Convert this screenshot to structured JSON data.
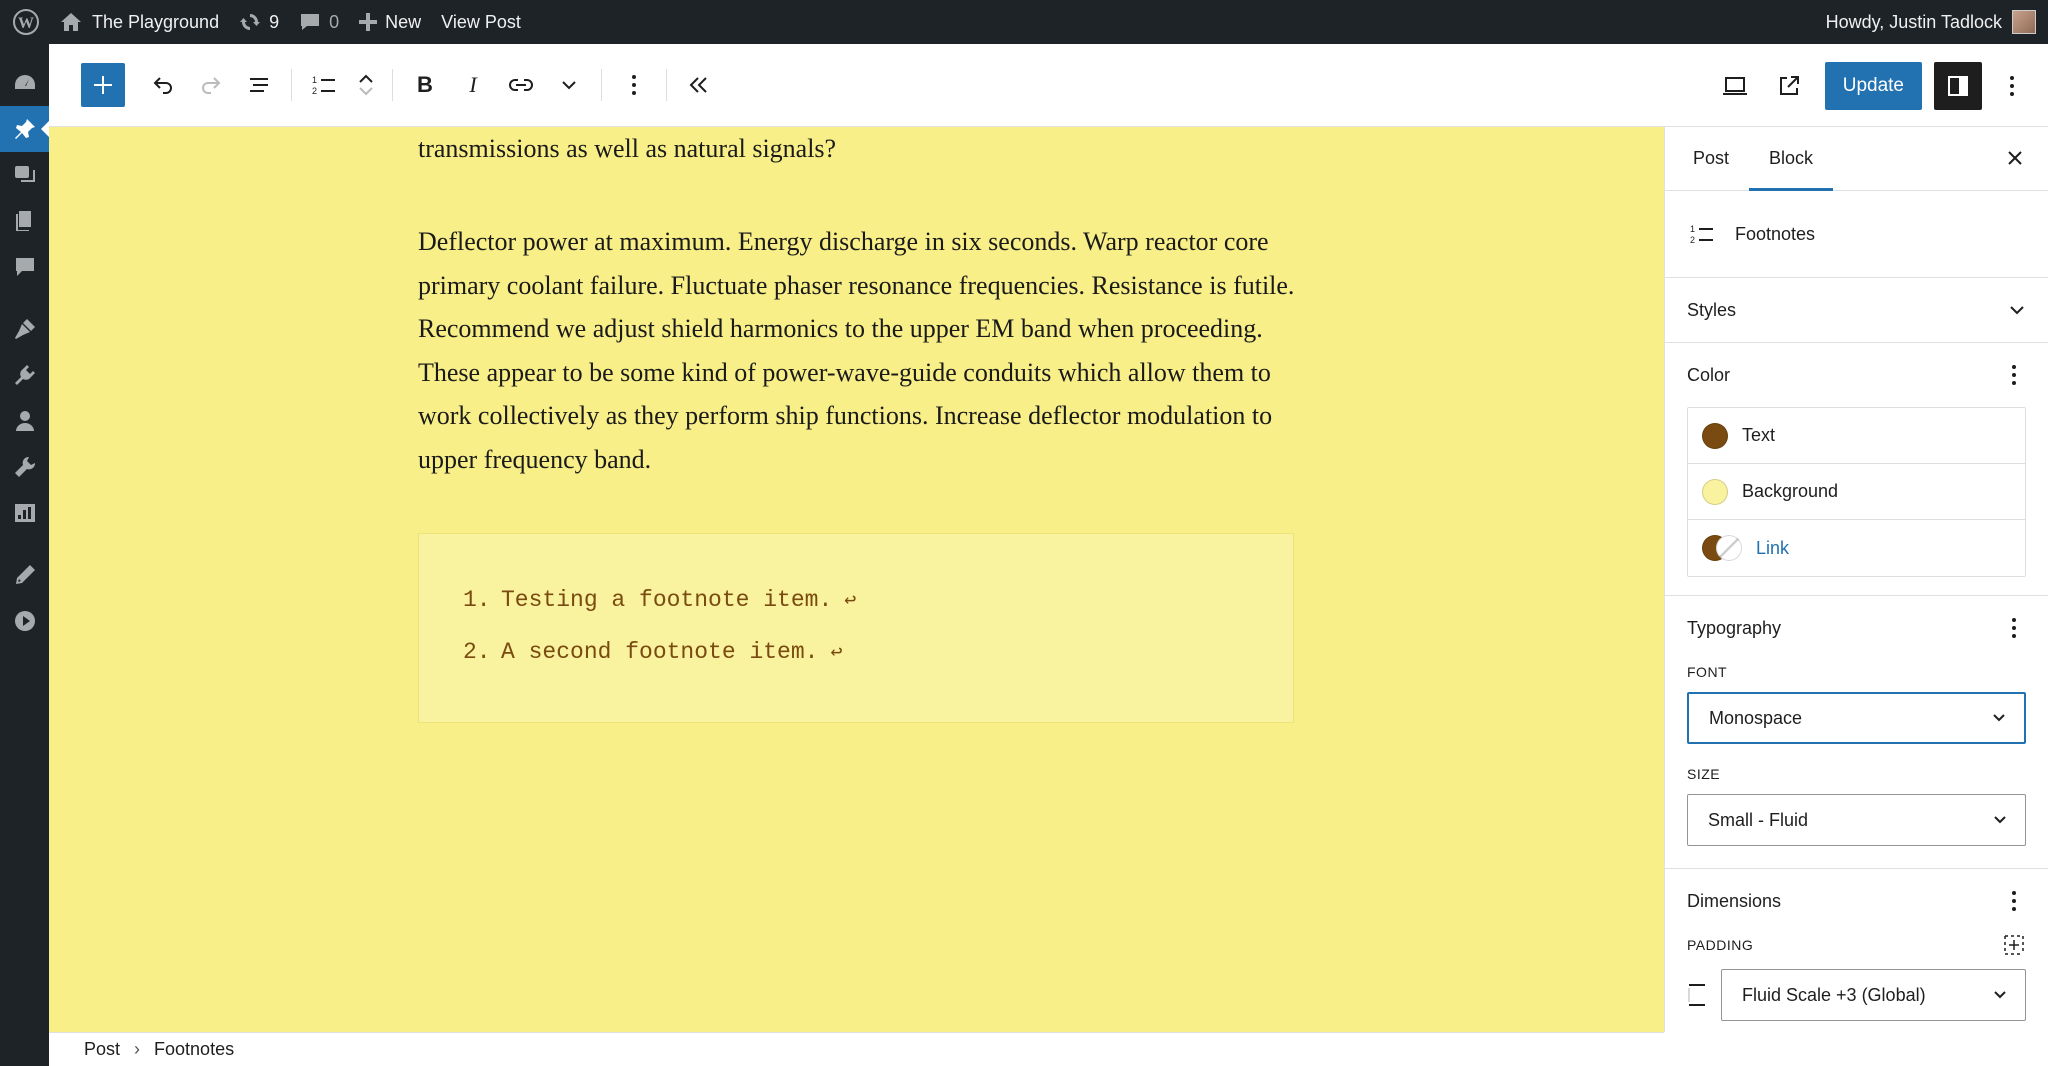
{
  "admin_bar": {
    "site_name": "The Playground",
    "updates_count": "9",
    "comments_count": "0",
    "new_label": "New",
    "view_post_label": "View Post",
    "greeting": "Howdy, Justin Tadlock"
  },
  "admin_menu": {
    "icons": [
      "dashboard-icon",
      "pin-icon",
      "media-icon",
      "pages-icon",
      "comments-icon",
      "appearance-icon",
      "plugins-icon",
      "users-icon",
      "tools-icon",
      "settings-icon",
      "edit-icon",
      "play-icon"
    ],
    "active": "pin-icon"
  },
  "toolbar": {
    "update_label": "Update"
  },
  "content": {
    "fragment": "transmissions as well as natural signals?",
    "paragraph": "Deflector power at maximum. Energy discharge in six seconds. Warp reactor core primary coolant failure. Fluctuate phaser resonance frequencies. Resistance is futile. Recommend we adjust shield harmonics to the upper EM band when proceeding. These appear to be some kind of power-wave-guide conduits which allow them to work collectively as they perform ship functions. Increase deflector modulation to upper frequency band.",
    "footnotes": [
      {
        "number": "1.",
        "text": "Testing a footnote item.",
        "backlink": "↩"
      },
      {
        "number": "2.",
        "text": "A second footnote item.",
        "backlink": "↩"
      }
    ]
  },
  "breadcrumb": {
    "root": "Post",
    "current": "Footnotes"
  },
  "sidebar": {
    "tabs": {
      "post": "Post",
      "block": "Block"
    },
    "block_name": "Footnotes",
    "styles_title": "Styles",
    "color": {
      "title": "Color",
      "text_label": "Text",
      "background_label": "Background",
      "link_label": "Link",
      "text_color": "#7a4b10",
      "background_color": "#f9f29e",
      "link_color": "#2271b1"
    },
    "typography": {
      "title": "Typography",
      "font_label": "FONT",
      "font_value": "Monospace",
      "size_label": "SIZE",
      "size_value": "Small - Fluid"
    },
    "dimensions": {
      "title": "Dimensions",
      "padding_label": "PADDING",
      "padding_value": "Fluid Scale +3 (Global)"
    }
  }
}
